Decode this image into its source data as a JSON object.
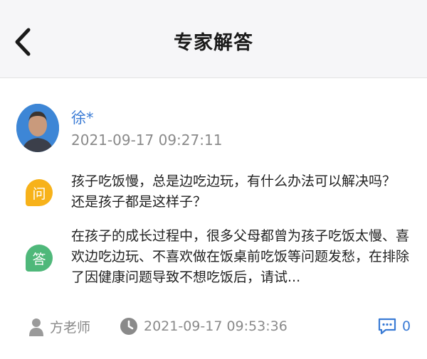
{
  "header": {
    "title": "专家解答",
    "back_icon": "chevron-left-icon"
  },
  "question": {
    "user_name": "徐*",
    "time": "2021-09-17 09:27:11",
    "badge": "问",
    "text": "孩子吃饭慢，总是边吃边玩，有什么办法可以解决吗？还是孩子都是这样子？"
  },
  "answer": {
    "badge": "答",
    "text": "在孩子的成长过程中，很多父母都曾为孩子吃饭太慢、喜欢边吃边玩、不喜欢做在饭桌前吃饭等问题发愁，在排除了因健康问题导致不想吃饭后，请试..."
  },
  "footer": {
    "teacher": "方老师",
    "time": "2021-09-17 09:53:36",
    "comment_count": "0"
  },
  "colors": {
    "accent": "#3a7bd5",
    "question_badge": "#f7b21a",
    "answer_badge": "#4fb87a",
    "muted": "#8a8a8a"
  }
}
